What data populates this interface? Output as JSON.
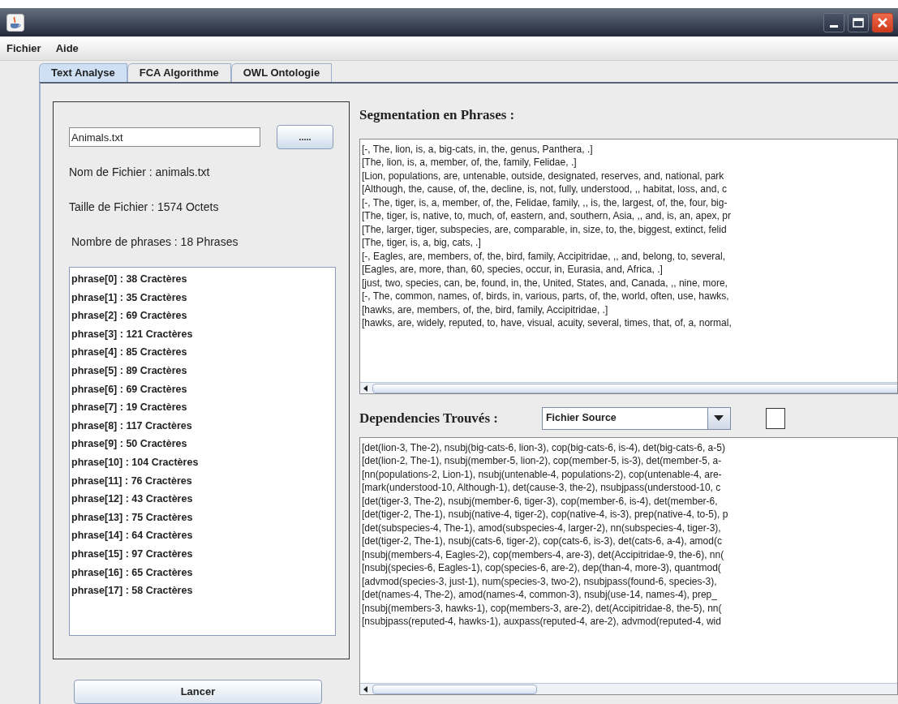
{
  "menu": [
    "Fichier",
    "Aide"
  ],
  "tabs": [
    {
      "label": "Text Analyse",
      "selected": true
    },
    {
      "label": "FCA Algorithme",
      "selected": false
    },
    {
      "label": "OWL Ontologie",
      "selected": false
    }
  ],
  "file_panel": {
    "file_field": {
      "value": "Animals.txt"
    },
    "browse_button": ".....",
    "info": [
      "Nom de Fichier : animals.txt",
      "Taille de Fichier : 1574 Octets",
      "Nombre de phrases : 18 Phrases"
    ],
    "phrases": [
      "phrase[0] : 38 Cractères",
      "phrase[1] : 35 Cractères",
      "phrase[2] : 69 Cractères",
      "phrase[3] : 121 Cractères",
      "phrase[4] : 85 Cractères",
      "phrase[5] : 89 Cractères",
      "phrase[6] : 69 Cractères",
      "phrase[7] : 19 Cractères",
      "phrase[8] : 117 Cractères",
      "phrase[9] : 50 Cractères",
      "phrase[10] : 104 Cractères",
      "phrase[11] : 76 Cractères",
      "phrase[12] : 43 Cractères",
      "phrase[13] : 75 Cractères",
      "phrase[14] : 64 Cractères",
      "phrase[15] : 97 Cractères",
      "phrase[16] : 65 Cractères",
      "phrase[17] : 58 Cractères"
    ],
    "run_button": "Lancer"
  },
  "segmentation": {
    "title": "Segmentation en Phrases :",
    "lines": [
      "[-, The, lion, is, a, big-cats, in, the, genus, Panthera, .]",
      "[The, lion, is, a, member, of, the, family, Felidae, .]",
      "[Lion, populations, are, untenable, outside, designated, reserves, and, national, park",
      "[Although, the, cause, of, the, decline, is, not, fully, understood, ,, habitat, loss, and, c",
      "[-, The, tiger, is, a, member, of, the, Felidae, family, ,, is, the, largest, of, the, four, big-",
      "[The, tiger, is, native, to, much, of, eastern, and, southern, Asia, ,, and, is, an, apex, pr",
      "[The, larger, tiger, subspecies, are, comparable, in, size, to, the, biggest, extinct, felid",
      "[The, tiger, is, a, big, cats, .]",
      "[-, Eagles, are, members, of, the, bird, family, Accipitridae, ,, and, belong, to, several,",
      "[Eagles, are, more, than, 60, species, occur, in, Eurasia, and, Africa, .]",
      "[just, two, species, can, be, found, in, the, United, States, and, Canada, ,, nine, more,",
      "[-, The, common, names, of, birds, in, various, parts, of, the, world, often, use, hawks,",
      "[hawks, are, members, of, the, bird, family, Accipitridae, .]",
      "[hawks, are, widely, reputed, to, have, visual, acuity, several, times, that, of, a, normal,"
    ]
  },
  "dependencies": {
    "title": "Dependencies Trouvés :",
    "source_select": {
      "value": "Fichier Source"
    },
    "checkbox": {
      "checked": false
    },
    "lines": [
      "[det(lion-3, The-2), nsubj(big-cats-6, lion-3), cop(big-cats-6, is-4), det(big-cats-6, a-5)",
      "[det(lion-2, The-1), nsubj(member-5, lion-2), cop(member-5, is-3), det(member-5, a-",
      "[nn(populations-2, Lion-1), nsubj(untenable-4, populations-2), cop(untenable-4, are-",
      "[mark(understood-10, Although-1), det(cause-3, the-2), nsubjpass(understood-10, c",
      "[det(tiger-3, The-2), nsubj(member-6, tiger-3), cop(member-6, is-4), det(member-6,",
      "[det(tiger-2, The-1), nsubj(native-4, tiger-2), cop(native-4, is-3), prep(native-4, to-5), p",
      "[det(subspecies-4, The-1), amod(subspecies-4, larger-2), nn(subspecies-4, tiger-3),",
      "[det(tiger-2, The-1), nsubj(cats-6, tiger-2), cop(cats-6, is-3), det(cats-6, a-4), amod(c",
      "[nsubj(members-4, Eagles-2), cop(members-4, are-3), det(Accipitridae-9, the-6), nn(",
      "[nsubj(species-6, Eagles-1), cop(species-6, are-2), dep(than-4, more-3), quantmod(",
      "[advmod(species-3, just-1), num(species-3, two-2), nsubjpass(found-6, species-3),",
      "[det(names-4, The-2), amod(names-4, common-3), nsubj(use-14, names-4), prep_",
      "[nsubj(members-3, hawks-1), cop(members-3, are-2), det(Accipitridae-8, the-5), nn(",
      "[nsubjpass(reputed-4, hawks-1), auxpass(reputed-4, are-2), advmod(reputed-4, wid"
    ]
  }
}
